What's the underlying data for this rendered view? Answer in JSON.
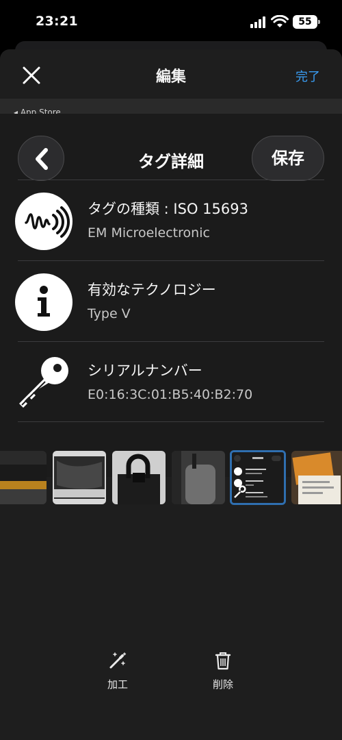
{
  "status": {
    "time": "23:21",
    "battery": "55"
  },
  "nav": {
    "title": "編集",
    "done_label": "完了"
  },
  "screenshot": {
    "back_label": "◂ App Store",
    "title": "タグ詳細",
    "save_label": "保存",
    "rows": [
      {
        "title": "タグの種類 : ISO 15693",
        "value": "EM Microelectronic",
        "icon": "nfc-wave-icon"
      },
      {
        "title": "有効なテクノロジー",
        "value": "Type V",
        "icon": "info-icon"
      },
      {
        "title": "シリアルナンバー",
        "value": "E0:16:3C:01:B5:40:B2:70",
        "icon": "key-icon"
      }
    ]
  },
  "thumbnails": [
    {
      "name": "thumb-bag-strap",
      "selected": false
    },
    {
      "name": "thumb-bag-inside",
      "selected": false
    },
    {
      "name": "thumb-bag-handle",
      "selected": false
    },
    {
      "name": "thumb-bag-tag",
      "selected": false
    },
    {
      "name": "thumb-tag-detail-screenshot",
      "selected": true
    },
    {
      "name": "thumb-receipt-box",
      "selected": false
    }
  ],
  "toolbar": {
    "edit_label": "加工",
    "delete_label": "削除"
  },
  "colors": {
    "accent": "#3a9ef5",
    "selected_border": "#2f6fb0",
    "background": "#1e1e1e"
  }
}
